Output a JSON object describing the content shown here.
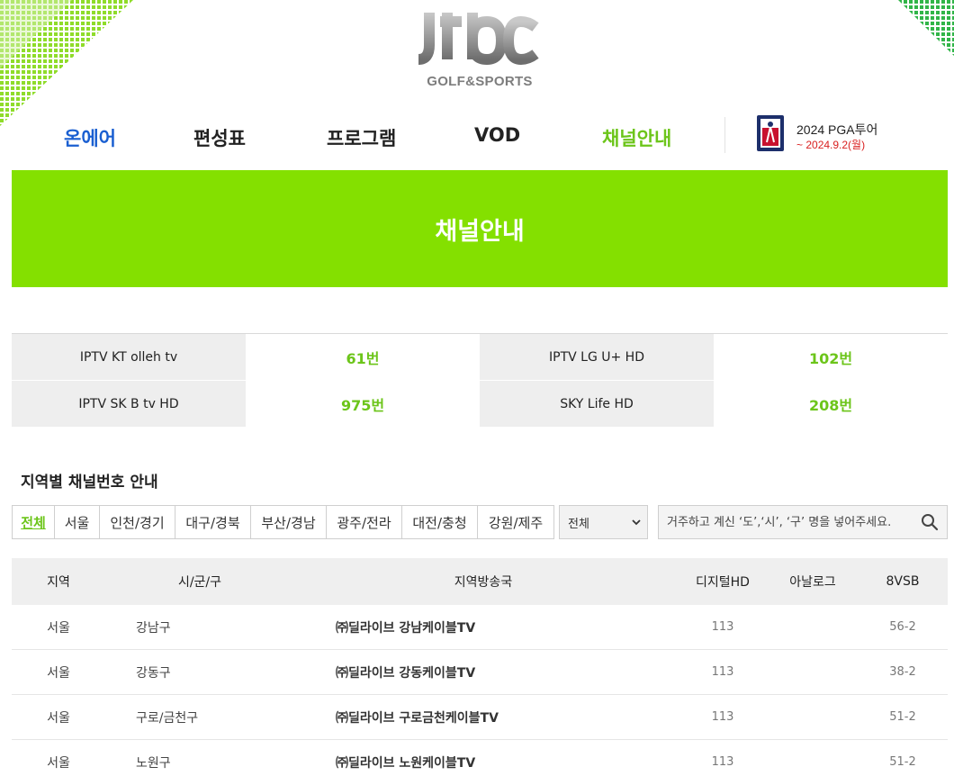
{
  "logo": {
    "main": "JTBC",
    "sub": "GOLF&SPORTS"
  },
  "nav": {
    "items": [
      {
        "label": "온에어",
        "state": "onair"
      },
      {
        "label": "편성표",
        "state": "normal"
      },
      {
        "label": "프로그램",
        "state": "normal"
      },
      {
        "label": "VOD",
        "state": "normal"
      },
      {
        "label": "채널안내",
        "state": "active"
      }
    ],
    "promo": {
      "title": "2024 PGA투어",
      "date": "~ 2024.9.2(월)"
    }
  },
  "banner": {
    "title": "채널안내"
  },
  "summary": [
    [
      {
        "label": "IPTV KT olleh tv",
        "value": "61번"
      },
      {
        "label": "IPTV LG U+ HD",
        "value": "102번"
      }
    ],
    [
      {
        "label": "IPTV SK B tv HD",
        "value": "975번"
      },
      {
        "label": "SKY Life HD",
        "value": "208번"
      }
    ]
  ],
  "region": {
    "title": "지역별 채널번호 안내",
    "tabs": [
      "전체",
      "서울",
      "인천/경기",
      "대구/경북",
      "부산/경남",
      "광주/전라",
      "대전/충청",
      "강원/제주"
    ],
    "active_tab": "전체",
    "select_value": "전체",
    "search_placeholder": "거주하고 계신 ‘도’,‘시’, ‘구’ 명을 넣어주세요."
  },
  "table": {
    "headers": [
      "지역",
      "시/군/구",
      "지역방송국",
      "디지털HD",
      "아날로그",
      "8VSB"
    ],
    "rows": [
      [
        "서울",
        "강남구",
        "㈜딜라이브 강남케이블TV",
        "113",
        "",
        "56-2"
      ],
      [
        "서울",
        "강동구",
        "㈜딜라이브 강동케이블TV",
        "113",
        "",
        "38-2"
      ],
      [
        "서울",
        "구로/금천구",
        "㈜딜라이브 구로금천케이블TV",
        "113",
        "",
        "51-2"
      ],
      [
        "서울",
        "노원구",
        "㈜딜라이브 노원케이블TV",
        "113",
        "",
        "51-2"
      ]
    ]
  },
  "colors": {
    "accent_green": "#84e000",
    "text_green": "#6cc51a",
    "onair_blue": "#1a5fd1",
    "promo_red": "#d92020"
  }
}
